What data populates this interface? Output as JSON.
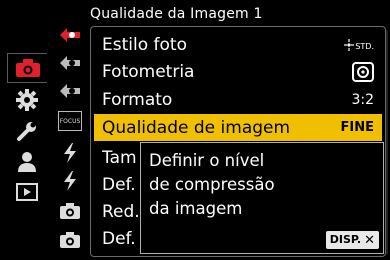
{
  "header": {
    "title": "Qualidade da Imagem 1"
  },
  "categories": [
    {
      "icon": "camera-icon",
      "active": true
    },
    {
      "icon": "gear-icon",
      "active": false
    },
    {
      "icon": "wrench-icon",
      "active": false
    },
    {
      "icon": "person-icon",
      "active": false
    },
    {
      "icon": "playback-icon",
      "active": false
    }
  ],
  "subtabs": [
    {
      "icon": "photo-quality-page-icon",
      "label": ""
    },
    {
      "icon": "photo-quality-page-2-icon",
      "label": ""
    },
    {
      "icon": "photo-quality-page-3-icon",
      "label": ""
    },
    {
      "icon": "focus-page-icon",
      "label": "FOCUS"
    },
    {
      "icon": "flash-page-icon",
      "label": ""
    },
    {
      "icon": "flash-page-2-icon",
      "label": ""
    },
    {
      "icon": "camera-page-icon",
      "label": ""
    },
    {
      "icon": "camera-page-2-icon",
      "label": ""
    }
  ],
  "menu": {
    "items": [
      {
        "label": "Estilo foto",
        "value": "STD."
      },
      {
        "label": "Fotometria",
        "value": ""
      },
      {
        "label": "Formato",
        "value": "3:2"
      },
      {
        "label": "Qualidade de imagem",
        "value": "FINE"
      },
      {
        "label": "Tam",
        "value": ""
      },
      {
        "label": "Def.",
        "value": ""
      },
      {
        "label": "Red.",
        "value": ""
      },
      {
        "label": "Def.",
        "value": ""
      }
    ]
  },
  "help": {
    "lines": [
      "Definir o nível",
      "de compressão",
      "da imagem"
    ],
    "disp_label": "DISP."
  },
  "colors": {
    "selected_bg": "#f0c000",
    "active_icon": "#e0202a"
  }
}
